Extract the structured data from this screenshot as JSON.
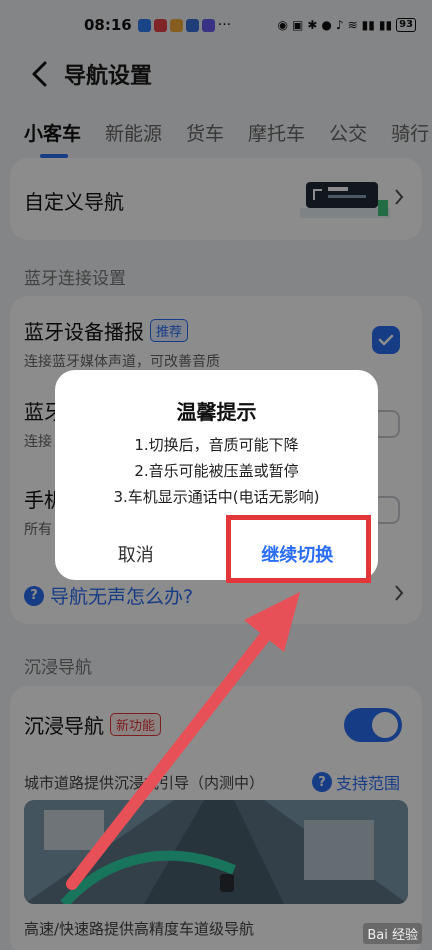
{
  "status_bar": {
    "time": "08:16",
    "more": "···",
    "battery": "93"
  },
  "header": {
    "title": "导航设置"
  },
  "tabs": [
    "小客车",
    "新能源",
    "货车",
    "摩托车",
    "公交",
    "骑行"
  ],
  "custom_nav": {
    "label": "自定义导航"
  },
  "bluetooth_section": {
    "title": "蓝牙连接设置",
    "broadcast": {
      "label": "蓝牙设备播报",
      "badge": "推荐",
      "sub": "连接蓝牙媒体声道，可改善音质"
    },
    "row2": {
      "label": "蓝牙",
      "sub": "连接"
    },
    "row3": {
      "label": "手机",
      "sub": "所有"
    }
  },
  "help": {
    "label": "导航无声怎么办?",
    "icon": "?"
  },
  "immersive_section": {
    "title": "沉浸导航",
    "toggle_row": {
      "label": "沉浸导航",
      "badge": "新功能"
    },
    "city_desc": "城市道路提供沉浸式引导（内测中）",
    "support_link": "支持范围",
    "highway_desc": "高速/快速路提供高精度车道级导航"
  },
  "dialog": {
    "title": "温馨提示",
    "lines": [
      "1.切换后，音质可能下降",
      "2.音乐可能被压盖或暂停",
      "3.车机显示通话中(电话无影响)"
    ],
    "cancel": "取消",
    "confirm": "继续切换"
  },
  "watermark": "Bai 经验"
}
